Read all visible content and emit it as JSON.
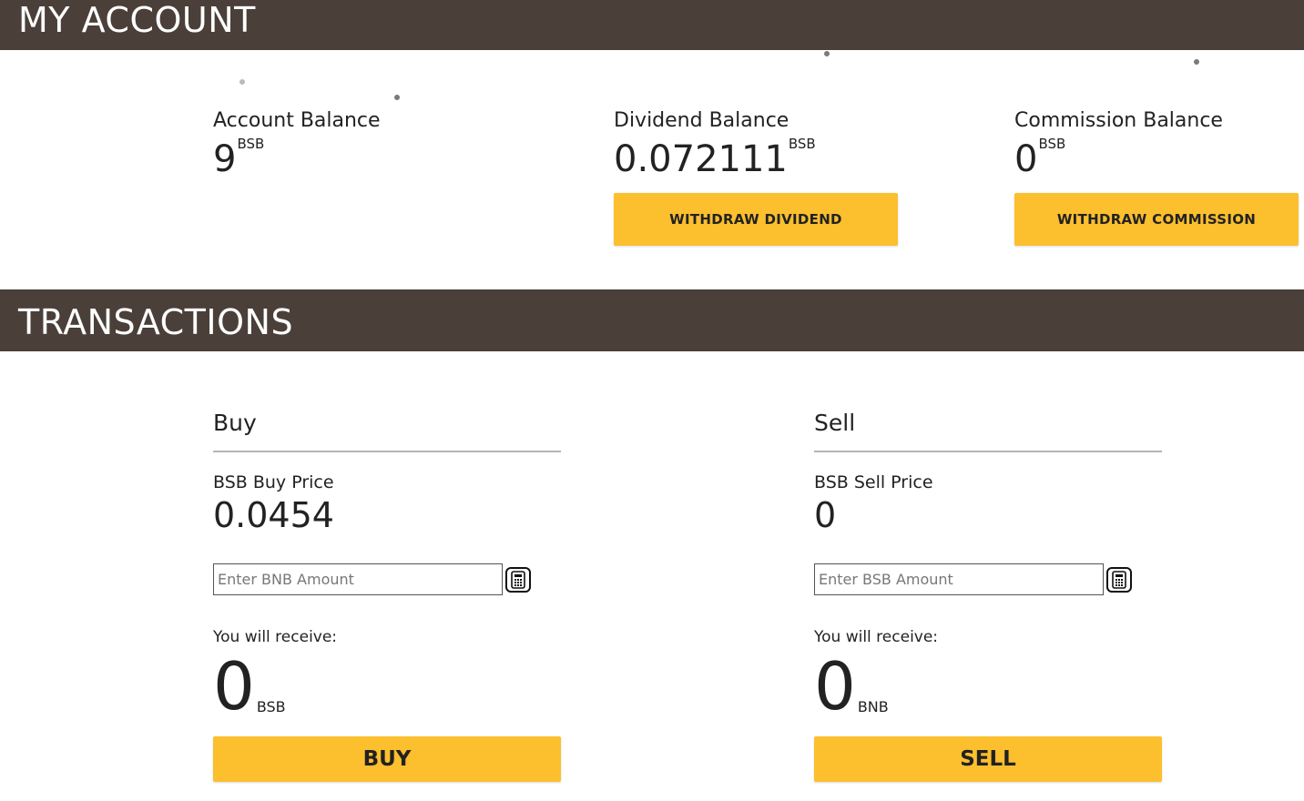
{
  "account": {
    "title": "MY ACCOUNT",
    "balances": [
      {
        "label": "Account Balance",
        "value": "9",
        "unit": "BSB"
      },
      {
        "label": "Dividend Balance",
        "value": "0.072111",
        "unit": "BSB",
        "button": "WITHDRAW DIVIDEND"
      },
      {
        "label": "Commission Balance",
        "value": "0",
        "unit": "BSB",
        "button": "WITHDRAW COMMISSION"
      }
    ]
  },
  "transactions": {
    "title": "TRANSACTIONS",
    "buy": {
      "heading": "Buy",
      "price_label": "BSB Buy Price",
      "price_value": "0.0454",
      "input_placeholder": "Enter BNB Amount",
      "receive_label": "You will receive:",
      "receive_value": "0",
      "receive_unit": "BSB",
      "button": "BUY",
      "calculator_icon": "calculator-icon"
    },
    "sell": {
      "heading": "Sell",
      "price_label": "BSB Sell Price",
      "price_value": "0",
      "input_placeholder": "Enter BSB Amount",
      "receive_label": "You will receive:",
      "receive_value": "0",
      "receive_unit": "BNB",
      "button": "SELL",
      "calculator_icon": "calculator-icon"
    }
  },
  "colors": {
    "header_band": "#4a3f39",
    "accent_button": "#fcbf2e",
    "text": "#222222"
  }
}
